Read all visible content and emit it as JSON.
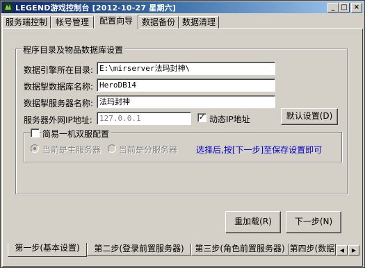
{
  "window": {
    "title": "LEGEND游戏控制台 [2012-10-27 星期六]",
    "min_icon": "minimize-icon",
    "max_icon": "maximize-icon",
    "close_icon": "close-icon"
  },
  "top_tabs": [
    {
      "label": "服务端控制"
    },
    {
      "label": "帐号管理"
    },
    {
      "label": "配置向导"
    },
    {
      "label": "数据备份"
    },
    {
      "label": "数据清理"
    }
  ],
  "active_top_tab": "配置向导",
  "db_group": {
    "title": "程序目录及物品数据库设置",
    "engine_dir_label": "数据引擎所在目录:",
    "engine_dir_value": "E:\\mirserver法玛封神\\",
    "db_name_label": "数据掣数据库名称:",
    "db_name_value": "HeroDB14",
    "server_name_label": "数据掣服务器名称:",
    "server_name_value": "法玛封神",
    "ip_label": "服务器外网IP地址:",
    "ip_value": "127.0.0.1",
    "dynamic_ip_label": "动态IP地址",
    "dynamic_ip_checked": true,
    "default_btn": "默认设置(D)"
  },
  "dual_group": {
    "title": "简易一机双服配置",
    "checked": false,
    "main_server_label": "当前是主服务器",
    "sub_server_label": "当前是分服务器",
    "hint": "选择后,按[下一步]至保存设置即可"
  },
  "buttons": {
    "reload": "重加载(R)",
    "next": "下一步(N)"
  },
  "bottom_tabs": [
    {
      "label": "第一步(基本设置)"
    },
    {
      "label": "第二步(登录前置服务器)"
    },
    {
      "label": "第三步(角色前置服务器)"
    },
    {
      "label": "第四步(数据"
    }
  ],
  "colors": {
    "title_start": "#0a246a",
    "title_end": "#a6caf0",
    "hint": "#0000c8",
    "face": "#d4d0c8"
  }
}
